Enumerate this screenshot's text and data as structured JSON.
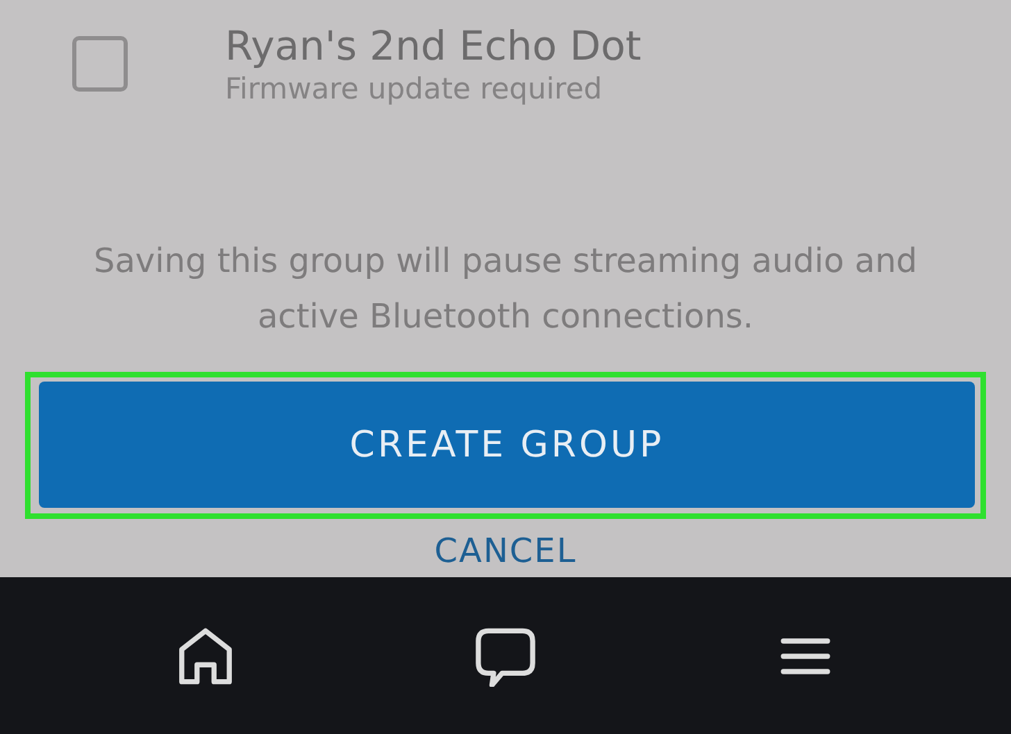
{
  "device": {
    "name": "Ryan's 2nd Echo Dot",
    "status": "Firmware update required",
    "checked": false
  },
  "notice": "Saving this group will pause streaming audio and active Bluetooth connections.",
  "primary_button": {
    "label": "CREATE GROUP",
    "highlighted": true
  },
  "secondary_button": {
    "label": "CANCEL"
  },
  "nav_bar": [
    {
      "kind": "home"
    },
    {
      "kind": "chat"
    },
    {
      "kind": "menu"
    }
  ]
}
